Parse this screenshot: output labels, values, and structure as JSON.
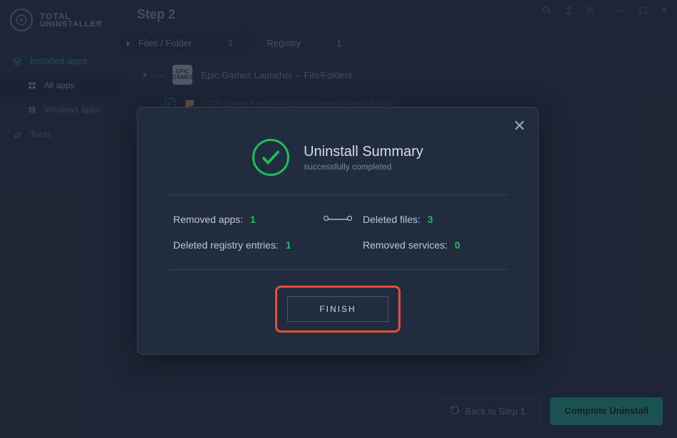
{
  "brand": {
    "line1": "TOTAL",
    "line2": "UNINSTALLER"
  },
  "sidebar": {
    "items": [
      {
        "label": "Installed apps",
        "icon": "layers"
      },
      {
        "label": "All apps",
        "icon": "grid"
      },
      {
        "label": "Windows apps",
        "icon": "windows"
      },
      {
        "label": "Tools",
        "icon": "wrench"
      }
    ]
  },
  "main": {
    "step_title": "Step 2",
    "tabs": [
      {
        "label": "Files / Folder",
        "count": "3"
      },
      {
        "label": "Registry",
        "count": "1"
      }
    ],
    "list": {
      "header": "Epic Games Launcher -- File/Folders",
      "app_icon_text": "EPIC\nGAMES",
      "rows": [
        {
          "path": "C:\\Program Files (x86)\\Epic Games\\DirectXRedist"
        }
      ]
    },
    "buttons": {
      "back": "Back to Step 1",
      "complete": "Complete Uninstall"
    }
  },
  "modal": {
    "title": "Uninstall Summary",
    "subtitle": "successfully completed",
    "stats": {
      "removed_apps_label": "Removed apps:",
      "removed_apps": "1",
      "deleted_files_label": "Deleted files:",
      "deleted_files": "3",
      "deleted_registry_label": "Deleted registry entries:",
      "deleted_registry": "1",
      "removed_services_label": "Removed services:",
      "removed_services": "0"
    },
    "finish": "FINISH"
  }
}
